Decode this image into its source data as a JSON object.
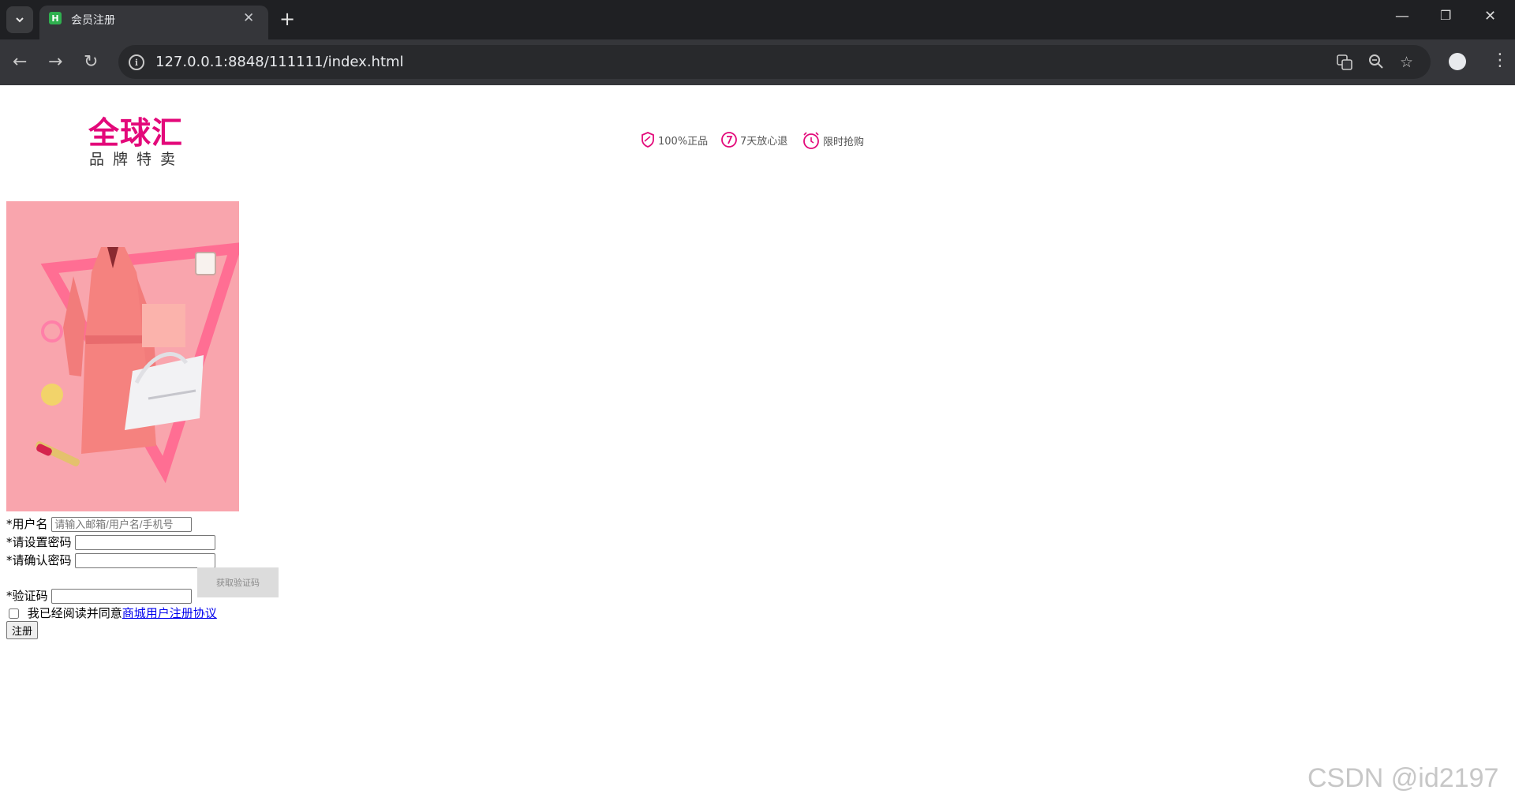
{
  "browser": {
    "tab_title": "会员注册",
    "favicon_letter": "H",
    "url": "127.0.0.1:8848/111111/index.html"
  },
  "header": {
    "logo_main": "全球汇",
    "logo_sub": "品牌特卖",
    "promises": [
      "100%正品",
      "7天放心退",
      "限时抢购"
    ]
  },
  "form": {
    "username_label": "*用户名",
    "username_placeholder": "请输入邮箱/用户名/手机号",
    "password_label": "*请设置密码",
    "confirm_label": "*请确认密码",
    "code_label": "*验证码",
    "get_code_button": "获取验证码",
    "agree_text": "我已经阅读并同意",
    "agree_link": "商城用户注册协议",
    "submit_label": "注册"
  },
  "watermark": "CSDN @id2197",
  "colors": {
    "brand": "#e3097a",
    "hero_bg": "#f9a5ad"
  }
}
